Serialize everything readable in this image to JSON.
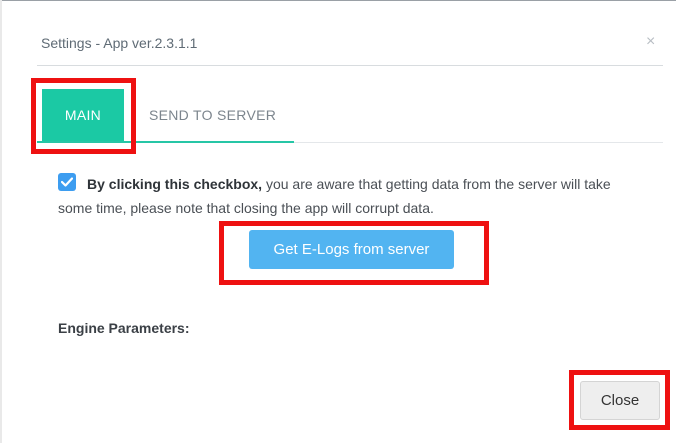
{
  "dialog": {
    "title": "Settings - App ver.2.3.1.1",
    "close_icon": "×"
  },
  "tabs": [
    {
      "label": "MAIN",
      "active": true
    },
    {
      "label": "SEND TO SERVER",
      "active": false
    }
  ],
  "notice": {
    "checked": true,
    "bold_text": "By clicking this checkbox,",
    "text": " you are aware that getting data from the server will take some time, please note that closing the app will corrupt data."
  },
  "get_logs_button": "Get E-Logs from server",
  "engine_parameters_label": "Engine Parameters:",
  "close_button": "Close",
  "colors": {
    "accent": "#1bc9a4",
    "primary_button": "#52b4f1",
    "checkbox": "#3d9df0",
    "highlight": "#ee1111"
  }
}
